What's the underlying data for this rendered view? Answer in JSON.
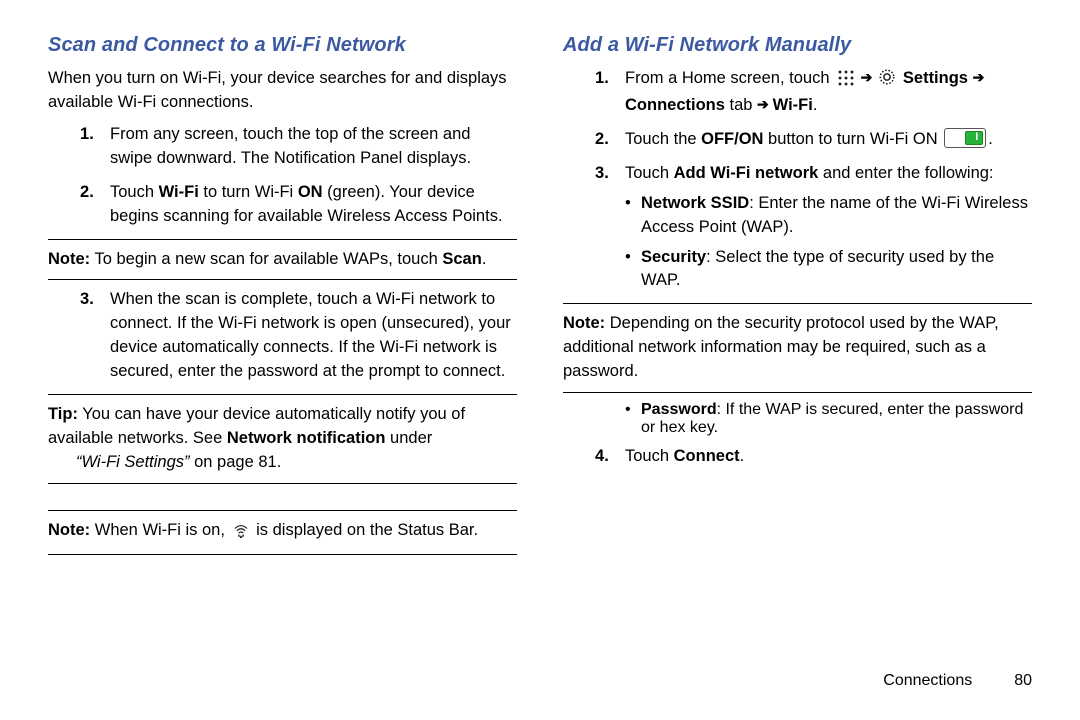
{
  "left": {
    "heading": "Scan and Connect to a Wi-Fi Network",
    "lead": "When you turn on Wi-Fi, your device searches for and displays available Wi-Fi connections.",
    "step1": "From any screen, touch the top of the screen and swipe downward. The Notification Panel displays.",
    "step2_a": "Touch ",
    "step2_b_bold": "Wi-Fi",
    "step2_c": " to turn Wi-Fi ",
    "step2_d_bold": "ON",
    "step2_e": " (green). Your device begins scanning for available Wireless Access Points.",
    "note1_label": "Note:",
    "note1_a": " To begin a new scan for available WAPs, touch ",
    "note1_b_bold": "Scan",
    "note1_c": ".",
    "step3": "When the scan is complete, touch a Wi-Fi network to connect. If the Wi-Fi network is open (unsecured), your device automatically connects. If the Wi-Fi network is secured, enter the password at the prompt to connect.",
    "tip_label": "Tip:",
    "tip_a": " You can have your device automatically notify you of available networks. See ",
    "tip_b_bold": "Network notification",
    "tip_c": " under ",
    "tip_d_italic": "“Wi-Fi Settings”",
    "tip_e": " on page 81.",
    "note2_label": "Note:",
    "note2_a": " When Wi-Fi is on, ",
    "note2_b": " is displayed on the Status Bar."
  },
  "right": {
    "heading": "Add a Wi-Fi Network Manually",
    "s1_a": "From a Home screen, touch ",
    "s1_settings": "Settings",
    "s1_conn_tab": "Connections",
    "s1_tab_word": " tab ",
    "s1_wifi": "Wi-Fi",
    "s1_end": ".",
    "s2_a": "Touch the ",
    "s2_b_bold": "OFF/ON",
    "s2_c": " button to turn Wi-Fi ON ",
    "s2_d": ".",
    "s3_a": "Touch ",
    "s3_b_bold": "Add Wi-Fi network",
    "s3_c": " and enter the following:",
    "b1_label": "Network SSID",
    "b1_text": ": Enter the name of the Wi-Fi Wireless Access Point (WAP).",
    "b2_label": "Security",
    "b2_text": ": Select the type of security used by the WAP.",
    "note_label": "Note:",
    "note_text": " Depending on the security protocol used by the WAP, additional network information may be required, such as a password.",
    "b3_label": "Password",
    "b3_text": ": If the WAP is secured, enter the password or hex key.",
    "s4_a": "Touch ",
    "s4_b_bold": "Connect",
    "s4_c": "."
  },
  "footer": {
    "section": "Connections",
    "page": "80"
  }
}
